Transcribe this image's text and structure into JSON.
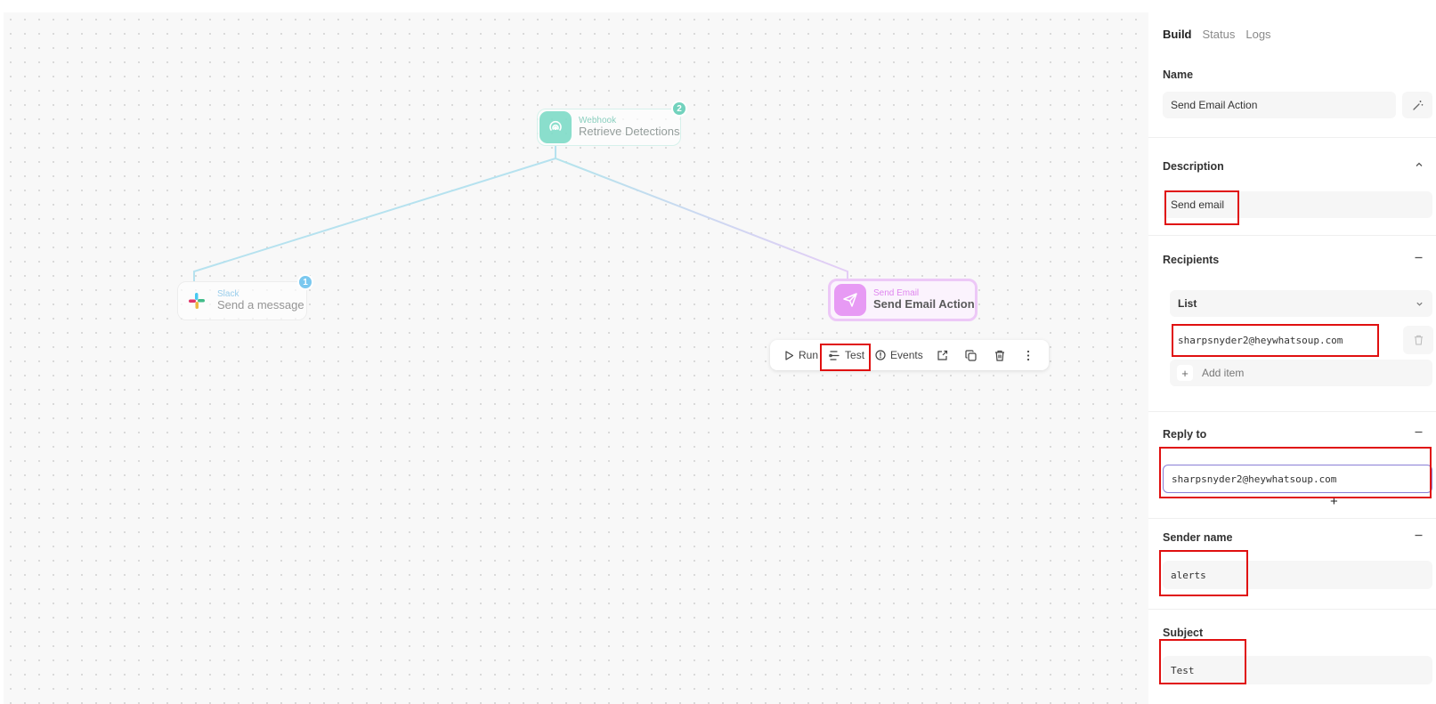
{
  "canvas": {
    "nodes": {
      "webhook": {
        "kind": "Webhook",
        "title": "Retrieve Detections",
        "badge": "2",
        "icon": "webhook-icon"
      },
      "slack": {
        "kind": "Slack",
        "title": "Send a message",
        "badge": "1",
        "icon": "slack-icon"
      },
      "email": {
        "kind": "Send Email",
        "title": "Send Email Action",
        "icon": "send-icon"
      }
    },
    "toolbar": {
      "run_label": "Run",
      "test_label": "Test",
      "events_label": "Events",
      "icons": [
        "play-icon",
        "test-icon",
        "events-icon",
        "export-icon",
        "duplicate-icon",
        "delete-icon",
        "more-icon"
      ]
    }
  },
  "panel": {
    "tabs": [
      "Build",
      "Status",
      "Logs"
    ],
    "active_tab": "Build",
    "name": {
      "label": "Name",
      "value": "Send Email Action"
    },
    "description": {
      "label": "Description",
      "value": "Send email"
    },
    "recipients": {
      "label": "Recipients",
      "mode": "List",
      "items": [
        "sharpsnyder2@heywhatsoup.com"
      ],
      "add_label": "Add item"
    },
    "reply_to": {
      "label": "Reply to",
      "value": "sharpsnyder2@heywhatsoup.com"
    },
    "sender_name": {
      "label": "Sender name",
      "value": "alerts"
    },
    "subject": {
      "label": "Subject",
      "value": "Test"
    }
  },
  "colors": {
    "webhook": "#7fdcc8",
    "slack_badge": "#7ac8ef",
    "email": "#e79af4",
    "highlight": "#e01010",
    "active_field_border": "#8a7fd6"
  }
}
